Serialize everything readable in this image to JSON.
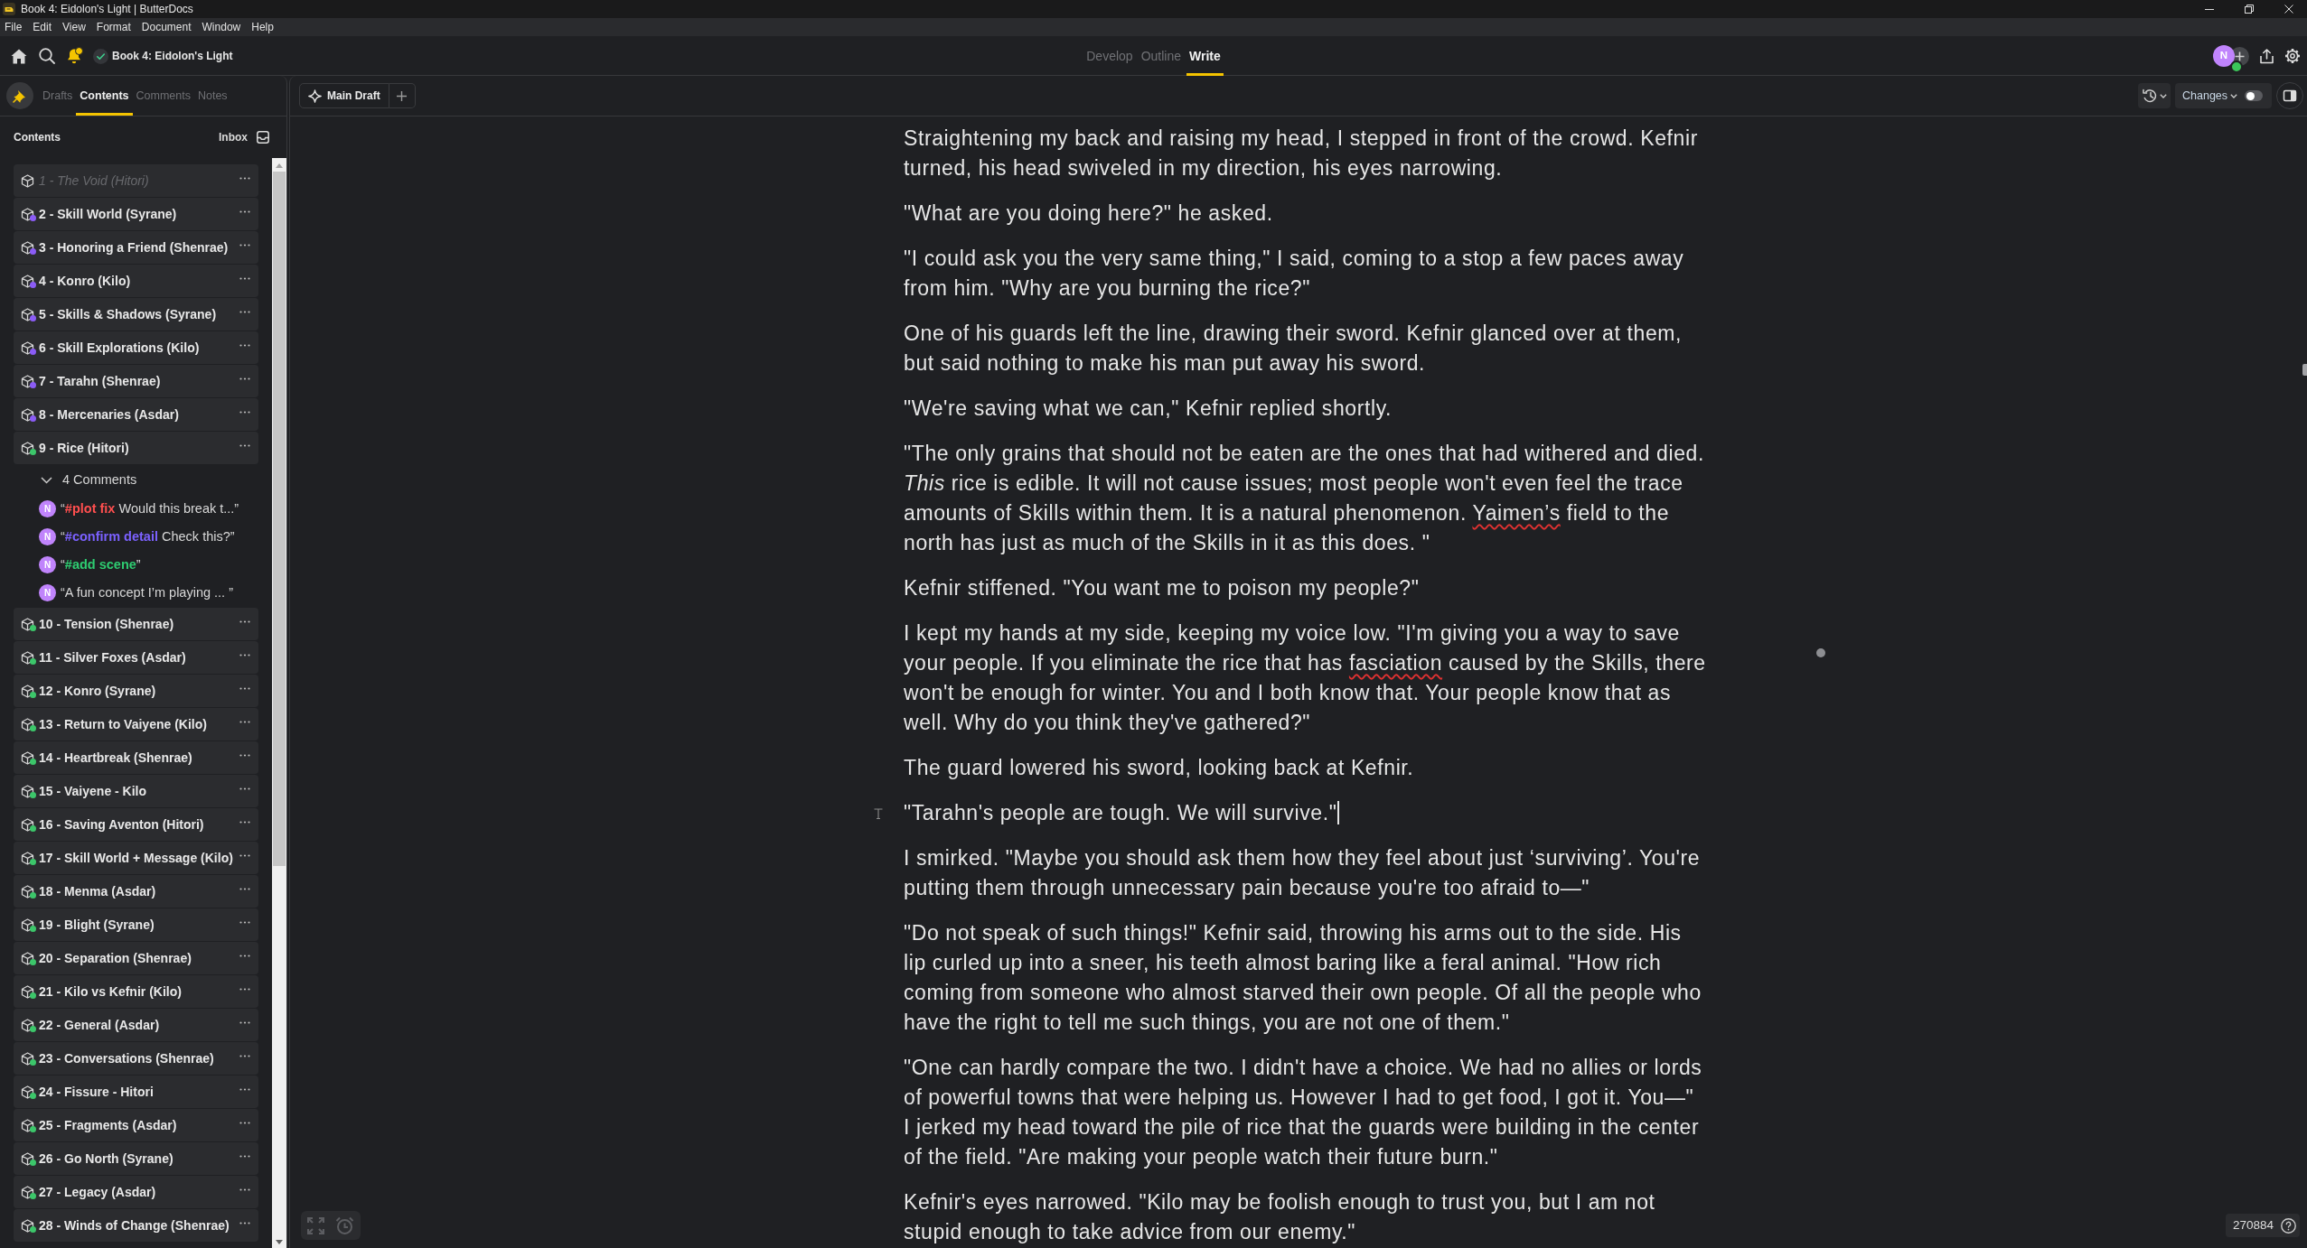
{
  "window": {
    "title": "Book 4: Eidolon's Light | ButterDocs"
  },
  "menu": [
    "File",
    "Edit",
    "View",
    "Format",
    "Document",
    "Window",
    "Help"
  ],
  "toolbar": {
    "notifications_unread": true,
    "saved": true,
    "document_title": "Book 4: Eidolon's Light",
    "modes": [
      {
        "label": "Develop",
        "selected": false
      },
      {
        "label": "Outline",
        "selected": false
      },
      {
        "label": "Write",
        "selected": true
      }
    ],
    "user": {
      "initial": "N",
      "online": true
    }
  },
  "sidebar": {
    "tabs": [
      {
        "label": "Drafts",
        "selected": false
      },
      {
        "label": "Contents",
        "selected": true
      },
      {
        "label": "Comments",
        "selected": false
      },
      {
        "label": "Notes",
        "selected": false
      }
    ],
    "heading": "Contents",
    "inbox_label": "Inbox",
    "chapters": [
      {
        "title": "1 - The Void (Hitori)",
        "excluded": true
      },
      {
        "title": "2 - Skill World (Syrane)",
        "excluded": false,
        "color": "#8b5cf6"
      },
      {
        "title": "3 - Honoring a Friend (Shenrae)",
        "excluded": false,
        "color": "#8b5cf6"
      },
      {
        "title": "4 - Konro (Kilo)",
        "excluded": false,
        "color": "#8b5cf6"
      },
      {
        "title": "5 - Skills & Shadows (Syrane)",
        "excluded": false,
        "color": "#8b5cf6"
      },
      {
        "title": "6 - Skill Explorations (Kilo)",
        "excluded": false,
        "color": "#8b5cf6"
      },
      {
        "title": "7 - Tarahn (Shenrae)",
        "excluded": false,
        "color": "#8b5cf6"
      },
      {
        "title": "8 - Mercenaries (Asdar)",
        "excluded": false,
        "color": "#8b5cf6"
      },
      {
        "title": "9 - Rice (Hitori)",
        "excluded": false,
        "color": "#3cc66a",
        "comments": {
          "label": "4 Comments",
          "expanded": true,
          "items": [
            {
              "author": "N",
              "runs": [
                {
                  "text": "“"
                },
                {
                  "text": "#plot fix",
                  "color": "#ff4f4f"
                },
                {
                  "text": " Would this break t...”"
                }
              ]
            },
            {
              "author": "N",
              "runs": [
                {
                  "text": "“"
                },
                {
                  "text": "#confirm detail",
                  "color": "#7b61ff"
                },
                {
                  "text": " Check this?”"
                }
              ]
            },
            {
              "author": "N",
              "runs": [
                {
                  "text": "“"
                },
                {
                  "text": "#add scene",
                  "color": "#2ecc71"
                },
                {
                  "text": "”"
                }
              ]
            },
            {
              "author": "N",
              "runs": [
                {
                  "text": "“A fun concept I’m playing ... ”"
                }
              ]
            }
          ]
        }
      },
      {
        "title": "10 - Tension (Shenrae)",
        "excluded": false,
        "color": "#3cc66a"
      },
      {
        "title": "11 - Silver Foxes (Asdar)",
        "excluded": false,
        "color": "#3cc66a"
      },
      {
        "title": "12 - Konro (Syrane)",
        "excluded": false,
        "color": "#3cc66a"
      },
      {
        "title": "13 - Return to Vaiyene (Kilo)",
        "excluded": false,
        "color": "#3cc66a"
      },
      {
        "title": "14 - Heartbreak (Shenrae)",
        "excluded": false,
        "color": "#3cc66a"
      },
      {
        "title": "15 - Vaiyene - Kilo",
        "excluded": false,
        "color": "#3cc66a"
      },
      {
        "title": "16 - Saving Aventon (Hitori)",
        "excluded": false,
        "color": "#3cc66a"
      },
      {
        "title": "17 - Skill World + Message (Kilo)",
        "excluded": false,
        "color": "#3cc66a"
      },
      {
        "title": "18 - Menma (Asdar)",
        "excluded": false,
        "color": "#3cc66a"
      },
      {
        "title": "19 - Blight (Syrane)",
        "excluded": false,
        "color": "#3cc66a"
      },
      {
        "title": "20 - Separation (Shenrae)",
        "excluded": false,
        "color": "#3cc66a"
      },
      {
        "title": "21 - Kilo vs Kefnir (Kilo)",
        "excluded": false,
        "color": "#3cc66a"
      },
      {
        "title": "22 - General (Asdar)",
        "excluded": false,
        "color": "#3cc66a"
      },
      {
        "title": "23 - Conversations (Shenrae)",
        "excluded": false,
        "color": "#3cc66a"
      },
      {
        "title": "24 - Fissure - Hitori",
        "excluded": false,
        "color": "#3cc66a"
      },
      {
        "title": "25 - Fragments (Asdar)",
        "excluded": false,
        "color": "#3cc66a"
      },
      {
        "title": "26 - Go North (Syrane)",
        "excluded": false,
        "color": "#3cc66a"
      },
      {
        "title": "27 - Legacy (Asdar)",
        "excluded": false,
        "color": "#3cc66a"
      },
      {
        "title": "28 - Winds of Change (Shenrae)",
        "excluded": false,
        "color": "#3cc66a"
      }
    ]
  },
  "editor": {
    "draft_tabs": [
      {
        "label": "Main Draft",
        "selected": true
      }
    ],
    "changes_label": "Changes",
    "changes_on": false,
    "paragraphs": [
      {
        "focused": false,
        "runs": [
          {
            "text": "Straightening my back and raising my head, I stepped in front of the crowd. Kefnir turned, his head swiveled in my direction, his eyes narrowing.",
            "misspelled": false
          }
        ]
      },
      {
        "focused": false,
        "runs": [
          {
            "text": "\"What are you doing here?\" he asked.",
            "misspelled": false
          }
        ]
      },
      {
        "focused": false,
        "runs": [
          {
            "text": "\"I could ask you the very same thing,\" I said, coming to a stop a few paces away from him. \"Why are you burning the rice?\"",
            "misspelled": false
          }
        ]
      },
      {
        "focused": false,
        "runs": [
          {
            "text": "One of his guards left the line, drawing their sword. Kefnir glanced over at them, but said nothing to make his man put away his sword.",
            "misspelled": false
          }
        ]
      },
      {
        "focused": false,
        "runs": [
          {
            "text": "\"We're saving what we can,\" Kefnir replied shortly.",
            "misspelled": false
          }
        ]
      },
      {
        "focused": false,
        "runs": [
          {
            "text": "\"The only grains that should not be eaten are the ones that had withered and died. *This* rice is edible. It will not cause issues; most people won't even feel the trace amounts of Skills within them. It is a natural phenomenon. ",
            "misspelled": false
          },
          {
            "text": "Yaimen’s",
            "misspelled": true
          },
          {
            "text": " field to the north has just as much of the Skills in it as this does. \"",
            "misspelled": false
          }
        ]
      },
      {
        "focused": false,
        "runs": [
          {
            "text": "Kefnir stiffened. \"You want me to poison my people?\"",
            "misspelled": false
          }
        ]
      },
      {
        "focused": false,
        "runs": [
          {
            "text": "I kept my hands at my side, keeping my voice low. \"I'm giving you a way to save your people. If you eliminate the rice that has ",
            "misspelled": false
          },
          {
            "text": "fasciation",
            "misspelled": true
          },
          {
            "text": " caused by the Skills, there won't be enough for winter. You and I both know that. Your people know that as well. Why do you think they've gathered?\"",
            "misspelled": false
          }
        ]
      },
      {
        "focused": false,
        "runs": [
          {
            "text": "The guard lowered his sword, looking back at Kefnir.",
            "misspelled": false
          }
        ]
      },
      {
        "focused": true,
        "runs": [
          {
            "text": "\"Tarahn's people are tough. We will survive.\"",
            "misspelled": false
          }
        ]
      },
      {
        "focused": false,
        "runs": [
          {
            "text": "I smirked. \"Maybe you should ask them how they feel about just ‘surviving’. You're putting them through unnecessary pain because you're too afraid to—\"",
            "misspelled": false
          }
        ]
      },
      {
        "focused": false,
        "runs": [
          {
            "text": "\"Do not speak of such things!\" Kefnir said, throwing his arms out to the side. His lip curled up into a sneer, his teeth almost baring like a feral animal. \"How rich coming from someone who almost starved their own people. Of all the people who have the right to tell me such things, you are not one of them.\"",
            "misspelled": false
          }
        ]
      },
      {
        "focused": false,
        "runs": [
          {
            "text": "\"One can hardly compare the two. I didn't have a choice. We had no allies or lords of powerful towns that were helping us. However I had to get food, I got it. You—\" I jerked my head toward the pile of rice that the guards were building in the center of the field. \"Are making your people watch their future burn.\"",
            "misspelled": false
          }
        ]
      },
      {
        "focused": false,
        "runs": [
          {
            "text": "Kefnir's eyes narrowed. \"Kilo may be foolish enough to trust you, but I am not stupid enough to take advice from our enemy.\"",
            "misspelled": false
          }
        ]
      }
    ],
    "word_count": "270884"
  }
}
